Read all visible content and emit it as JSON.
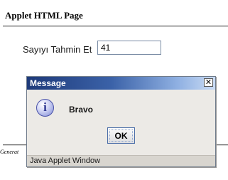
{
  "page": {
    "title": "Applet HTML Page",
    "generated_text": "Generat"
  },
  "applet": {
    "guess_label": "Sayıyı Tahmin Et",
    "guess_value": "41"
  },
  "dialog": {
    "title": "Message",
    "close_symbol": "✕",
    "icon_symbol": "i",
    "message": "Bravo",
    "ok_label": "OK",
    "status_text": "Java Applet Window",
    "icon": "info-icon",
    "colors": {
      "titlebar_start": "#1e3a7a",
      "titlebar_end": "#c9dbf4",
      "background": "#eceae6"
    }
  }
}
